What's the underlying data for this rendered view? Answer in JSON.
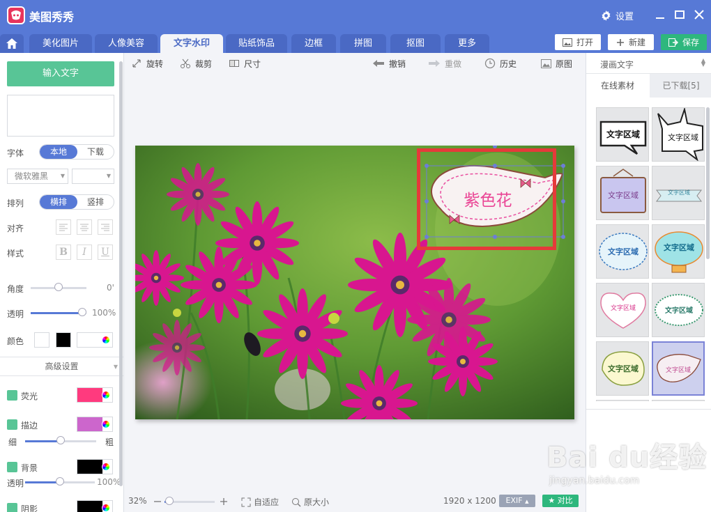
{
  "app": {
    "title": "美图秀秀",
    "settings_label": "设置"
  },
  "tabs": [
    {
      "label": "美化图片"
    },
    {
      "label": "人像美容"
    },
    {
      "label": "文字水印",
      "active": true
    },
    {
      "label": "贴纸饰品"
    },
    {
      "label": "边框"
    },
    {
      "label": "拼图"
    },
    {
      "label": "抠图"
    },
    {
      "label": "更多"
    }
  ],
  "top_buttons": {
    "open": "打开",
    "new": "新建",
    "save": "保存"
  },
  "left": {
    "input_text_button": "输入文字",
    "text_value": "",
    "font_label": "字体",
    "font_source": [
      "本地",
      "下载"
    ],
    "font_source_selected": "本地",
    "font_name": "微软雅黑",
    "font_size": "",
    "arrange_label": "排列",
    "arrange_options": [
      "横排",
      "竖排"
    ],
    "arrange_selected": "横排",
    "align_label": "对齐",
    "style_label": "样式",
    "style_buttons": [
      "B",
      "I",
      "U"
    ],
    "angle_label": "角度",
    "angle_value": "0'",
    "angle_fraction": 0.5,
    "opacity_label": "透明",
    "opacity_value": "100%",
    "opacity_fraction": 1.0,
    "color_label": "颜色",
    "color_value": "#000000",
    "advanced_label": "高级设置",
    "glow_label": "荧光",
    "glow_color": "#ff3a7e",
    "stroke_label": "描边",
    "stroke_color": "#cc66cc",
    "stroke_thin": "细",
    "stroke_thick": "粗",
    "stroke_fraction": 0.5,
    "bg_label": "背景",
    "bg_color": "#000000",
    "bg_opacity_label": "透明",
    "bg_opacity_value": "100%",
    "bg_opacity_fraction": 0.5,
    "shadow_label": "阴影",
    "shadow_color": "#000000"
  },
  "toolbar": {
    "rotate": "旋转",
    "crop": "裁剪",
    "size": "尺寸",
    "undo": "撤销",
    "redo": "重做",
    "history": "历史",
    "original": "原图"
  },
  "canvas": {
    "sticker_text": "紫色花"
  },
  "status": {
    "zoom": "32%",
    "zoom_fraction": 0.1,
    "fit": "自适应",
    "actual_size": "原大小",
    "dimensions": "1920 x 1200",
    "exif": "EXIF",
    "compare": "对比"
  },
  "right": {
    "category": "漫画文字",
    "tab_online": "在线素材",
    "tab_downloaded": "已下载[5]",
    "sticker_label": "文字区域"
  },
  "watermark": {
    "brand": "Bai du经验",
    "url": "jingyan.baidu.com"
  },
  "colors": {
    "accent": "#5779d6",
    "green": "#58c596",
    "save": "#2eb77d",
    "highlight": "#e53a3a"
  }
}
